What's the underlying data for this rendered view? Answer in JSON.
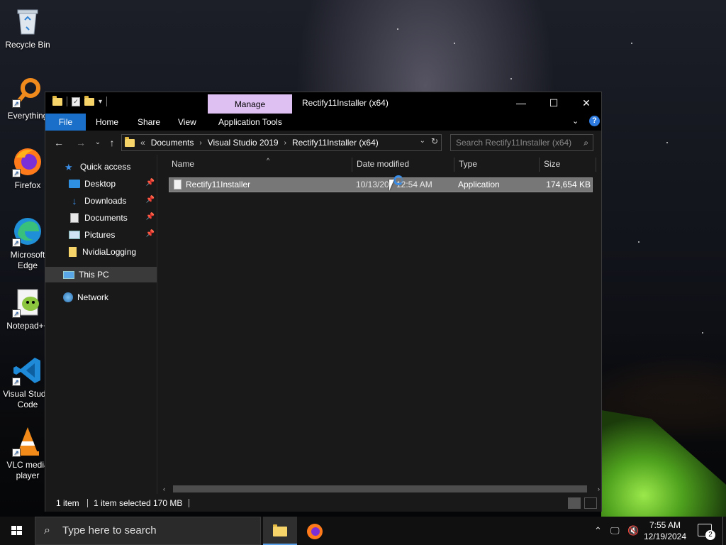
{
  "desktop": {
    "icons": [
      {
        "label": "Recycle Bin",
        "icon": "recycle-bin-icon"
      },
      {
        "label": "Everything",
        "icon": "everything-search-icon"
      },
      {
        "label": "Firefox",
        "icon": "firefox-icon"
      },
      {
        "label": "Microsoft Edge",
        "icon": "edge-icon"
      },
      {
        "label": "Notepad++",
        "icon": "notepad-plus-plus-icon"
      },
      {
        "label": "Visual Studio Code",
        "icon": "vscode-icon"
      },
      {
        "label": "VLC media player",
        "icon": "vlc-icon"
      }
    ]
  },
  "window": {
    "title": "Rectify11Installer (x64)",
    "contextual_tab": "Manage",
    "controls": {
      "minimize": "—",
      "maximize": "☐",
      "close": "✕"
    }
  },
  "ribbon": {
    "tabs": [
      "File",
      "Home",
      "Share",
      "View",
      "Application Tools"
    ],
    "help": "?"
  },
  "address": {
    "overflow": "«",
    "crumbs": [
      "Documents",
      "Visual Studio 2019",
      "Rectify11Installer (x64)"
    ],
    "search_placeholder": "Search Rectify11Installer (x64)"
  },
  "nav": {
    "quick_access": "Quick access",
    "pinned": [
      "Desktop",
      "Downloads",
      "Documents",
      "Pictures"
    ],
    "other": [
      "NvidiaLogging"
    ],
    "this_pc": "This PC",
    "network": "Network"
  },
  "columns": [
    "Name",
    "Date modified",
    "Type",
    "Size"
  ],
  "files": [
    {
      "name": "Rectify11Installer",
      "date": "10/13/20",
      "time": "12:54 AM",
      "type": "Application",
      "size": "174,654 KB"
    }
  ],
  "status": {
    "count": "1 item",
    "selected": "1 item selected",
    "size": "170 MB"
  },
  "taskbar": {
    "search_placeholder": "Type here to search",
    "time": "7:55 AM",
    "date": "12/19/2024",
    "notifications": "2"
  },
  "colors": {
    "accent": "#1a6fc9",
    "manage_tab": "#dec0f2",
    "selection": "#777777"
  }
}
